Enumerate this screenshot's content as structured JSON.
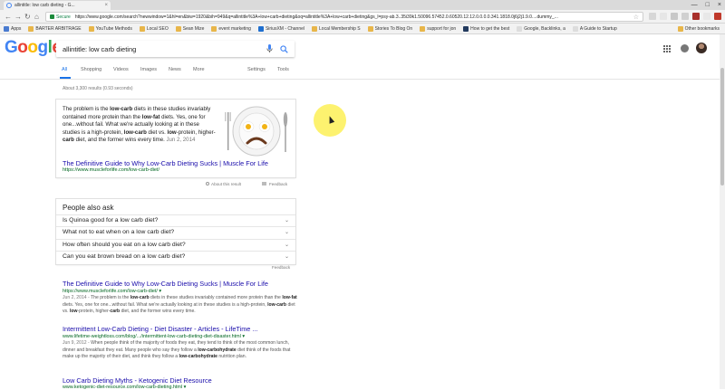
{
  "browser": {
    "tab_title": "allintitle: low carb dieting - G...",
    "tab_close": "×",
    "window_controls": [
      "—",
      "□",
      "×"
    ],
    "nav": {
      "back": "←",
      "forward": "→",
      "reload": "↻",
      "home": "⌂"
    },
    "secure_label": "Secure",
    "url": "https://www.google.com/search?newwindow=1&hl=en&biw=1920&bih=949&q=allintitle%3A+low+carb+dieting&oq=allintitle%3A+low+carb+dieting&gs_l=psy-ab.3..35i39k1.50096.57452.0.60520.12.12.0.0.0.0.341.1818.0j6j2j1.9.0....dummy_...",
    "star": "☆",
    "bookmarks": [
      "Apps",
      "BARTER ARBITRAGE",
      "YouTube Methods",
      "Local SEO",
      "Sean Mize",
      "event marketing",
      "SiriusXM - Channel",
      "Local Membership S",
      "Stories To Blog On",
      "support for jon",
      "How to get the best",
      "Google, Backlinks, a",
      "A Guide to Startup"
    ],
    "other_bookmarks": "Other bookmarks"
  },
  "google": {
    "logo_letters": [
      "G",
      "o",
      "o",
      "g",
      "l",
      "e"
    ],
    "logo_colors": [
      "#4285F4",
      "#EA4335",
      "#FBBC05",
      "#4285F4",
      "#34A853",
      "#EA4335"
    ],
    "query": "allintitle: low carb dieting",
    "tabs": [
      "All",
      "Shopping",
      "Videos",
      "Images",
      "News",
      "More"
    ],
    "tools": [
      "Settings",
      "Tools"
    ],
    "stats": "About 3,300 results (0.93 seconds)"
  },
  "featured_snippet": {
    "t1": "The problem is the ",
    "b1": "low-carb",
    "t2": " diets in these studies invariably contained more protein than the ",
    "b2": "low-",
    "b3": "fat",
    "t3": " diets. Yes, one for one...without fail. What we're actually looking at in these studies is a high-protein, ",
    "b4": "low-carb",
    "t4": " diet vs. ",
    "b5": "low",
    "t5": "-protein, higher-",
    "b6": "carb",
    "t6": " diet, and the former wins every time.",
    "date": "Jun 2, 2014",
    "title": "The Definitive Guide to Why Low-Carb Dieting Sucks | Muscle For Life",
    "url": "https://www.muscleforlife.com/low-carb-diet/",
    "about": "About this result",
    "feedback": "Feedback"
  },
  "people_also_ask": {
    "heading": "People also ask",
    "questions": [
      "Is Quinoa good for a low carb diet?",
      "What not to eat when on a low carb diet?",
      "How often should you eat on a low carb diet?",
      "Can you eat brown bread on a low carb diet?"
    ],
    "feedback": "Feedback"
  },
  "results": [
    {
      "title": "The Definitive Guide to Why Low-Carb Dieting Sucks | Muscle For Life",
      "url": "https://www.muscleforlife.com/low-carb-diet/",
      "date": "Jun 2, 2014 -",
      "s1": " The problem is the ",
      "b1": "low-carb",
      "s2": " diets in these studies invariably contained more protein than the ",
      "b2": "low-fat",
      "s3": " diets. Yes, one for one...without fail. What we're actually looking at in these studies is a high-protein, ",
      "b3": "low-carb",
      "s4": " diet vs. ",
      "b4": "low",
      "s5": "-protein, higher-",
      "b5": "carb",
      "s6": " diet, and the former wins every time."
    },
    {
      "title": "Intermittent Low-Carb Dieting - Diet Disaster - Articles - LifeTime ...",
      "url": "www.lifetime-weightloss.com/blog/.../intermittent-low-carb-dieting-diet-disaster.html",
      "date": "Jun 9, 2012 -",
      "s1": " When people think of the majority of foods they eat, they tend to think of the most common lunch, dinner and breakfast they eat. Many people who say they follow a ",
      "b1": "low-carbohydrate",
      "s2": " diet think of the foods that make up the majority of their diet, and think they follow a ",
      "b2": "low-carbohydrate",
      "s3": " nutrition plan."
    },
    {
      "title": "Low Carb Dieting Myths - Ketogenic Diet Resource",
      "url": "www.ketogenic-diet-resource.com/low-carb-dieting.html"
    }
  ],
  "url_dropdown": "▾",
  "chevron": "⌄"
}
